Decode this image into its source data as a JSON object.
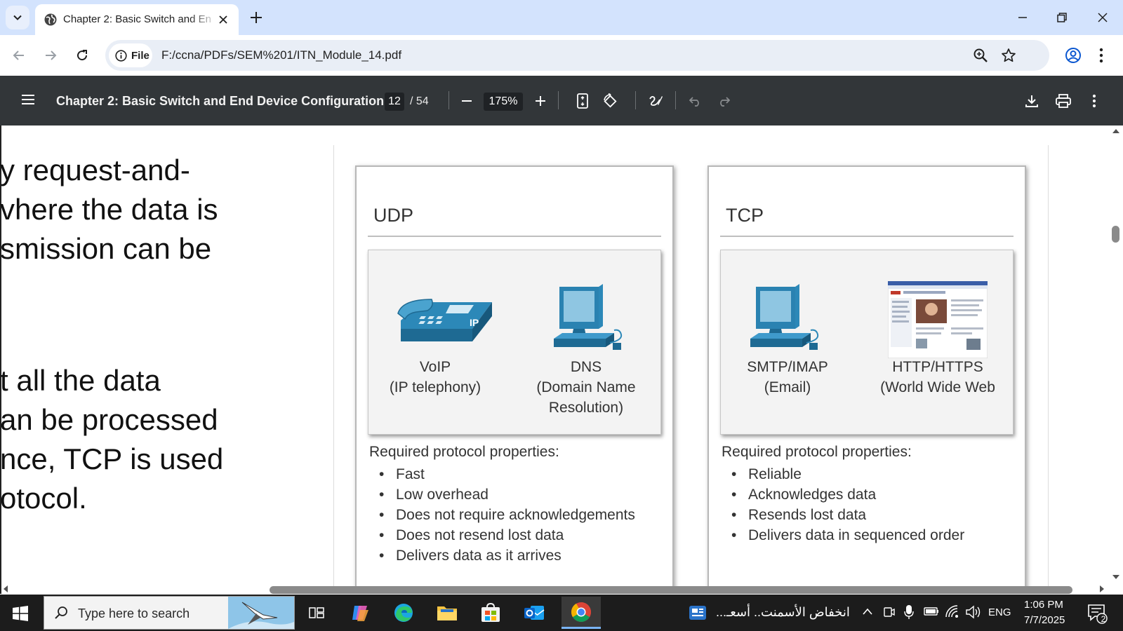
{
  "browser": {
    "tab_title": "Chapter 2: Basic Switch and End Device Configuration",
    "url_chip": "File",
    "url": "F:/ccna/PDFs/SEM%201/ITN_Module_14.pdf"
  },
  "pdf_toolbar": {
    "doc_title": "Chapter 2: Basic Switch and End Device Configuration",
    "page_current": "12",
    "page_total": "/ 54",
    "zoom": "175%"
  },
  "page": {
    "left_text": [
      "y request-and-",
      "vhere the data is",
      "smission can be",
      "t all the data",
      "an be processed",
      "nce, TCP is used",
      "otocol."
    ],
    "udp": {
      "title": "UDP",
      "apps": [
        {
          "line1": "VoIP",
          "line2": "(IP telephony)",
          "line3": ""
        },
        {
          "line1": "DNS",
          "line2": "(Domain Name",
          "line3": "Resolution)"
        }
      ],
      "props_heading": "Required protocol properties:",
      "props": [
        "Fast",
        "Low overhead",
        "Does not require acknowledgements",
        "Does not resend lost data",
        "Delivers data as it arrives"
      ]
    },
    "tcp": {
      "title": "TCP",
      "apps": [
        {
          "line1": "SMTP/IMAP",
          "line2": "(Email)"
        },
        {
          "line1": "HTTP/HTTPS",
          "line2": "(World Wide Web"
        }
      ],
      "props_heading": "Required protocol properties:",
      "props": [
        "Reliable",
        "Acknowledges data",
        "Resends lost data",
        "Delivers data in sequenced order"
      ]
    },
    "phone_label": "IP"
  },
  "taskbar": {
    "search_placeholder": "Type here to search",
    "news": "انخفاض الأسمنت.. أسعـ...",
    "lang": "ENG",
    "time": "1:06 PM",
    "date": "7/7/2025",
    "notif_count": "2"
  },
  "colors": {
    "tabstrip": "#d3e3fd",
    "pdf_toolbar": "#323639",
    "device_blue": "#2c88b8",
    "taskbar": "#1c1c1c"
  }
}
